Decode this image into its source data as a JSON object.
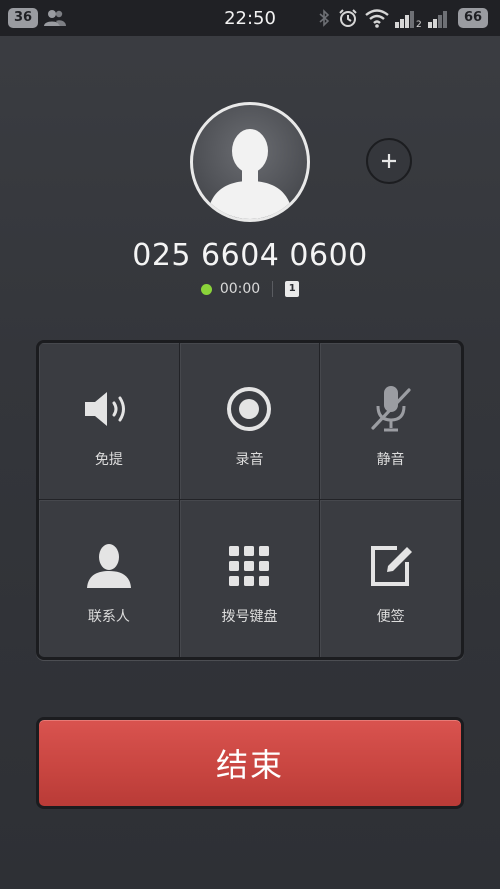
{
  "status_bar": {
    "notification_count": "36",
    "time": "22:50",
    "battery": "66",
    "icons": [
      "contacts-icon",
      "bluetooth-icon",
      "alarm-icon",
      "wifi-icon",
      "signal-1-icon",
      "signal-2-icon"
    ]
  },
  "contact": {
    "phone_number": "025 6604 0600",
    "duration": "00:00",
    "sim_slot": "1"
  },
  "actions": [
    {
      "label": "免提",
      "icon": "speaker-icon"
    },
    {
      "label": "录音",
      "icon": "record-icon"
    },
    {
      "label": "静音",
      "icon": "mute-icon"
    },
    {
      "label": "联系人",
      "icon": "contact-icon"
    },
    {
      "label": "拨号键盘",
      "icon": "dialpad-icon"
    },
    {
      "label": "便签",
      "icon": "note-icon"
    }
  ],
  "end_call": {
    "label": "结束"
  },
  "colors": {
    "accent_green": "#8bd43a",
    "end_call_red": "#c94641",
    "background": "#34363b"
  }
}
